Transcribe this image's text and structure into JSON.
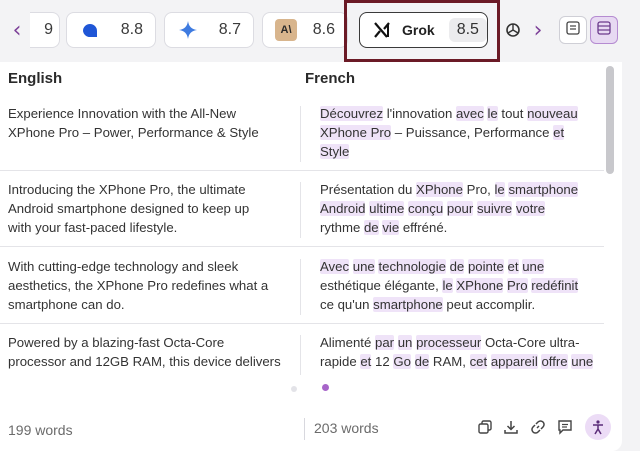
{
  "colors": {
    "accent": "#7c3f98",
    "highlight_bg": "#efe3f8",
    "frame": "#6b1a26"
  },
  "model_bar": {
    "prev_icon": "chevron-left-icon",
    "next_icon": "chevron-right-icon",
    "models": [
      {
        "name": "",
        "icon": "partial-model-icon",
        "score": "9"
      },
      {
        "name": "",
        "icon": "blue-circle-model-icon",
        "score": "8.8"
      },
      {
        "name": "",
        "icon": "gemini-sparkle-icon",
        "score": "8.7"
      },
      {
        "name": "",
        "icon": "anthropic-icon",
        "icon_text": "A\\",
        "score": "8.6"
      },
      {
        "name": "Grok",
        "icon": "grok-x-icon",
        "score": "8.5",
        "selected": true
      },
      {
        "name": "",
        "icon": "openai-icon",
        "score": ""
      }
    ],
    "view_buttons": [
      {
        "icon": "list-view-icon",
        "active": false
      },
      {
        "icon": "split-view-icon",
        "active": true
      }
    ]
  },
  "columns": {
    "source": "English",
    "target": "French"
  },
  "rows": [
    {
      "source_lines": [
        "Experience Innovation with the All-New",
        "XPhone Pro – Power, Performance & Style"
      ],
      "target_lines": [
        "Découvrez l'innovation avec le tout nouveau",
        "XPhone Pro – Puissance, Performance et",
        "Style"
      ]
    },
    {
      "source_lines": [
        "Introducing the XPhone Pro, the ultimate",
        "Android smartphone designed to keep up",
        "with your fast-paced lifestyle."
      ],
      "target_lines": [
        "Présentation du XPhone Pro, le smartphone",
        "Android ultime conçu pour suivre votre",
        "rythme de vie effréné."
      ]
    },
    {
      "source_lines": [
        "With cutting-edge technology and sleek",
        "aesthetics, the XPhone Pro redefines what a",
        "smartphone can do."
      ],
      "target_lines": [
        "Avec une technologie de pointe et une",
        "esthétique élégante, le XPhone Pro redéfinit",
        "ce qu'un smartphone peut accomplir."
      ]
    },
    {
      "source_lines": [
        "Powered by a blazing-fast Octa-Core",
        "processor and 12GB RAM, this device delivers"
      ],
      "target_lines": [
        "Alimenté par un processeur Octa-Core ultra-",
        "rapide et 12 Go de RAM, cet appareil offre une"
      ]
    }
  ],
  "pagination": {
    "pages": 2,
    "current": 2
  },
  "footer": {
    "source_count": "199 words",
    "target_count": "203 words",
    "actions": [
      {
        "icon": "copy-icon"
      },
      {
        "icon": "download-icon"
      },
      {
        "icon": "link-icon"
      },
      {
        "icon": "comment-icon"
      },
      {
        "icon": "accessibility-icon"
      }
    ]
  }
}
